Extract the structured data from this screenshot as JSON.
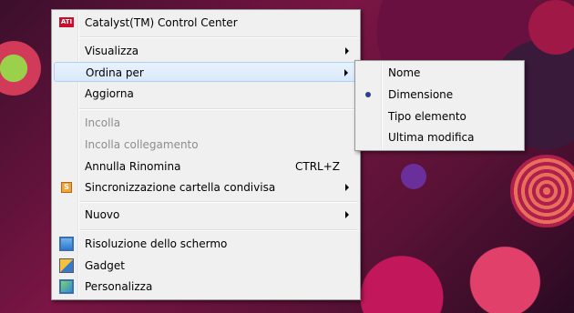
{
  "context_menu": {
    "items": [
      {
        "label": "Catalyst(TM) Control Center",
        "icon": "ati-icon"
      },
      {
        "label": "Visualizza"
      },
      {
        "label": "Ordina per"
      },
      {
        "label": "Aggiorna"
      },
      {
        "label": "Incolla"
      },
      {
        "label": "Incolla collegamento"
      },
      {
        "label": "Annulla Rinomina",
        "shortcut": "CTRL+Z"
      },
      {
        "label": "Sincronizzazione cartella condivisa",
        "icon": "sync-icon"
      },
      {
        "label": "Nuovo"
      },
      {
        "label": "Risoluzione dello schermo",
        "icon": "screen-resolution-icon"
      },
      {
        "label": "Gadget",
        "icon": "gadget-icon"
      },
      {
        "label": "Personalizza",
        "icon": "personalize-icon"
      }
    ]
  },
  "icons": {
    "ati_text": "ATI",
    "sync_text": "S"
  },
  "submenu": {
    "selected": "Dimensione",
    "items": [
      {
        "label": "Nome"
      },
      {
        "label": "Dimensione"
      },
      {
        "label": "Tipo elemento"
      },
      {
        "label": "Ultima modifica"
      }
    ]
  }
}
